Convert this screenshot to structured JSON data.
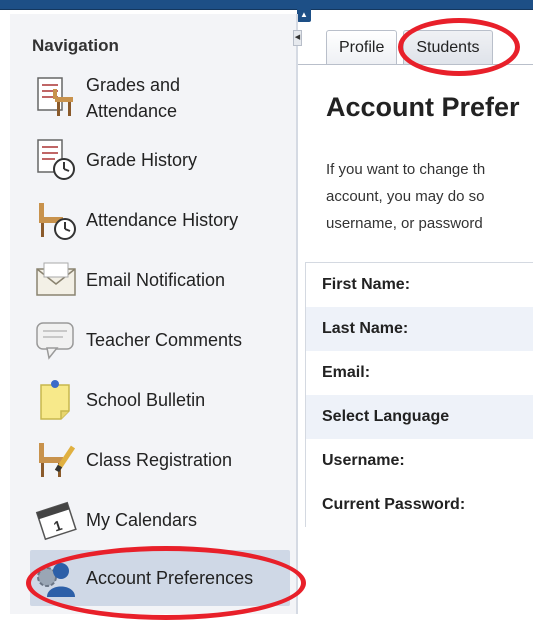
{
  "sidebar": {
    "heading": "Navigation",
    "items": [
      {
        "label": "Grades and Attendance",
        "line1": "Grades and",
        "line2": "Attendance",
        "icon": "gradebook-chair-icon"
      },
      {
        "label": "Grade History",
        "icon": "gradebook-clock-icon"
      },
      {
        "label": "Attendance History",
        "icon": "chair-clock-icon"
      },
      {
        "label": "Email Notification",
        "icon": "envelope-icon"
      },
      {
        "label": "Teacher Comments",
        "icon": "speech-bubble-icon"
      },
      {
        "label": "School Bulletin",
        "icon": "sticky-note-pin-icon"
      },
      {
        "label": "Class Registration",
        "icon": "chair-pencil-icon"
      },
      {
        "label": "My Calendars",
        "icon": "calendar-icon"
      },
      {
        "label": "Account Preferences",
        "icon": "user-gear-icon"
      }
    ],
    "selected_index": 8
  },
  "tabs": [
    {
      "label": "Profile"
    },
    {
      "label": "Students"
    }
  ],
  "main": {
    "title": "Account Prefer",
    "description_lines": [
      "If you want to change th",
      "account, you may do so",
      "username, or password"
    ]
  },
  "form": {
    "rows": [
      {
        "label": "First Name:"
      },
      {
        "label": "Last Name:"
      },
      {
        "label": "Email:"
      },
      {
        "label": "Select Language"
      },
      {
        "label": "Username:"
      },
      {
        "label": "Current Password:"
      }
    ]
  },
  "colors": {
    "highlight_ring": "#e8202a",
    "topbar": "#1d4f86",
    "selected_item": "#cfd8e6"
  }
}
